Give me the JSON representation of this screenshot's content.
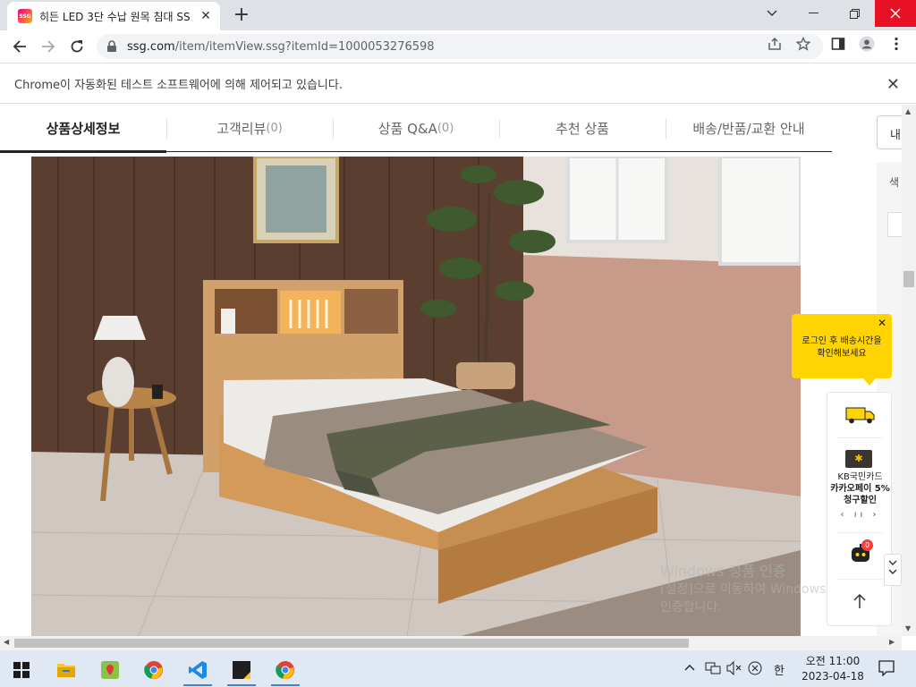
{
  "browser": {
    "tab_title": "히든 LED 3단 수납 원목 침대 SS",
    "favicon_text": "SSG",
    "url_host": "ssg.com",
    "url_path": "/item/itemView.ssg?itemId=1000053276598",
    "infobar_text": "Chrome이 자동화된 테스트 소프트웨어에 의해 제어되고 있습니다."
  },
  "page": {
    "tabs": [
      {
        "label": "상품상세정보",
        "count": ""
      },
      {
        "label": "고객리뷰",
        "count": "(0)"
      },
      {
        "label": "상품 Q&A",
        "count": "(0)"
      },
      {
        "label": "추천 상품",
        "count": ""
      },
      {
        "label": "배송/반품/교환 안내",
        "count": ""
      }
    ],
    "right_button_label": "내",
    "right_panel_label": "색"
  },
  "tooltip": {
    "line1": "로그인 후 배송시간을",
    "line2": "확인해보세요"
  },
  "quick_menu": {
    "card_line1": "KB국민카드",
    "card_line2": "카카오페이 5%",
    "card_line3": "청구할인",
    "pager": "‹ ıı ›",
    "badge": "0"
  },
  "watermark": {
    "line1": "Windows 정품 인증",
    "line2": "[설정]으로 이동하여 Windows를 정품",
    "line3": "인증합니다."
  },
  "taskbar": {
    "time": "오전 11:00",
    "date": "2023-04-18",
    "ime": "한"
  }
}
